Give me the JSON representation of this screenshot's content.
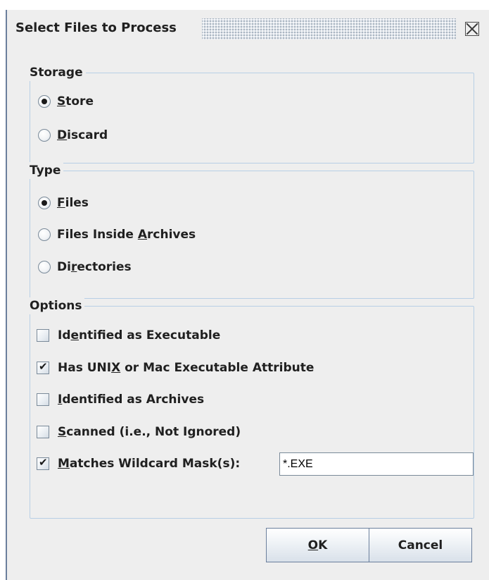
{
  "dialog": {
    "title": "Select Files to Process"
  },
  "storage": {
    "label": "Storage",
    "options": [
      {
        "pre": "",
        "mn": "S",
        "post": "tore",
        "selected": true
      },
      {
        "pre": "",
        "mn": "D",
        "post": "iscard",
        "selected": false
      }
    ]
  },
  "type": {
    "label": "Type",
    "options": [
      {
        "pre": "",
        "mn": "F",
        "post": "iles",
        "selected": true
      },
      {
        "pre": "Files Inside ",
        "mn": "A",
        "post": "rchives",
        "selected": false
      },
      {
        "pre": "Di",
        "mn": "r",
        "post": "ectories",
        "selected": false
      }
    ]
  },
  "options": {
    "label": "Options",
    "items": [
      {
        "pre": "Id",
        "mn": "e",
        "post": "ntified as Executable",
        "checked": false
      },
      {
        "pre": "Has UNI",
        "mn": "X",
        "post": " or Mac Executable Attribute",
        "checked": true
      },
      {
        "pre": "",
        "mn": "I",
        "post": "dentified as Archives",
        "checked": false
      },
      {
        "pre": "",
        "mn": "S",
        "post": "canned (i.e., Not Ignored)",
        "checked": false
      },
      {
        "pre": "",
        "mn": "M",
        "post": "atches Wildcard Mask(s):",
        "checked": true
      }
    ],
    "mask_value": "*.EXE"
  },
  "buttons": {
    "ok": {
      "pre": "",
      "mn": "O",
      "post": "K"
    },
    "cancel": "Cancel"
  }
}
